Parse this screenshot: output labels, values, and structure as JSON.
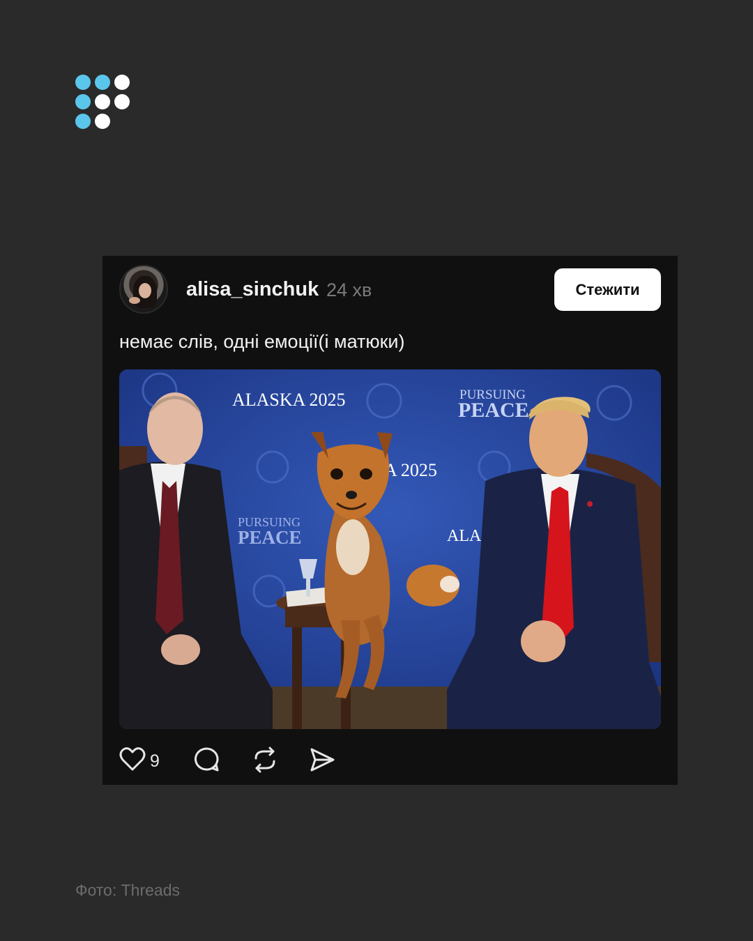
{
  "logo": {
    "colors": {
      "blue": "#5bc6ec",
      "white": "#ffffff"
    }
  },
  "post": {
    "username": "alisa_sinchuk",
    "time": "24 хв",
    "follow_label": "Стежити",
    "text": "немає слів, одні емоції(і матюки)",
    "image_text": {
      "alaska_1": "ALASKA 2025",
      "pursuing_1": "PURSUING",
      "peace_1": "PEACE",
      "alaska_2": "A 2025",
      "pursuing_2": "PURSUING",
      "peace_2": "PEACE",
      "alaska_3": "ALASI"
    },
    "likes_count": "9",
    "icons": [
      "heart-icon",
      "comment-icon",
      "repost-icon",
      "share-icon"
    ]
  },
  "credit": "Фото: Threads",
  "colors": {
    "background": "#2a2a2a",
    "card": "#101010",
    "backdrop_blue": "#2747a0"
  }
}
